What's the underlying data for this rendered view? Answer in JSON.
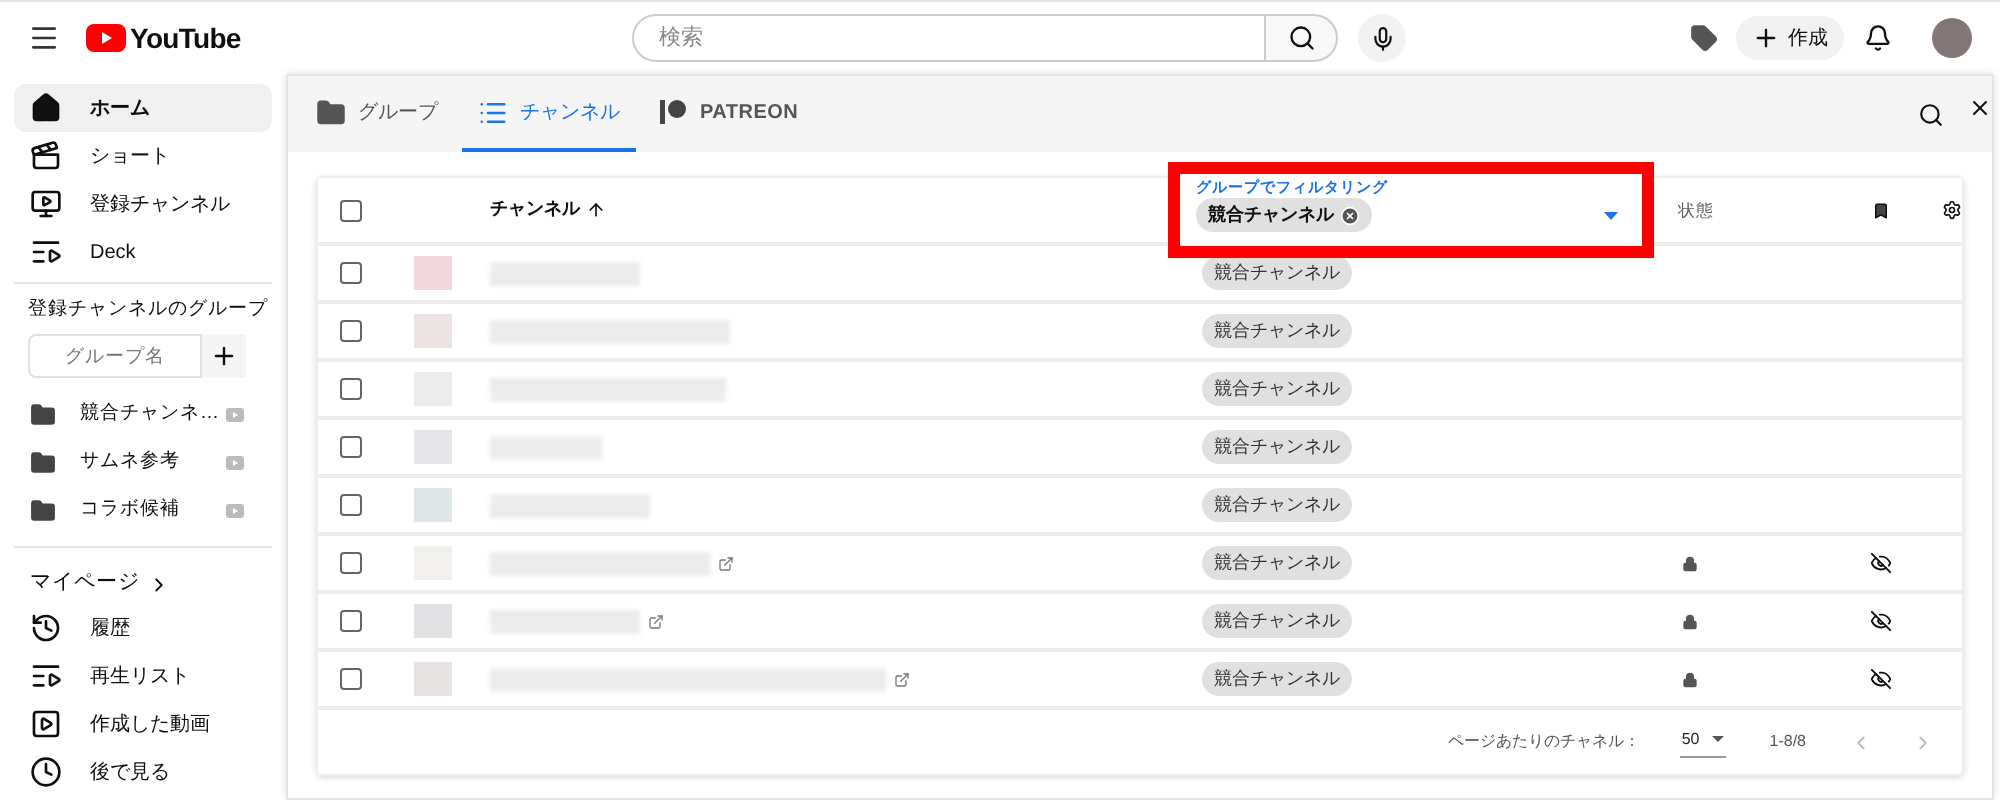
{
  "topbar": {
    "logo": "YouTube",
    "search": {
      "placeholder": "検索"
    },
    "create_button": "作成"
  },
  "sidebar": {
    "items": [
      {
        "label": "ホーム",
        "kind": "home",
        "selected": true
      },
      {
        "label": "ショート",
        "kind": "shorts",
        "selected": false
      },
      {
        "label": "登録チャンネル",
        "kind": "subscriptions",
        "selected": false
      },
      {
        "label": "Deck",
        "kind": "deck",
        "selected": false
      }
    ],
    "groups_title": "登録チャンネルのグループ",
    "group_name": {
      "placeholder": "グループ名"
    },
    "groups": [
      "競合チャンネ…",
      "サムネ参考",
      "コラボ候補"
    ],
    "mypage": "マイページ",
    "my_items": [
      {
        "label": "履歴",
        "kind": "history"
      },
      {
        "label": "再生リスト",
        "kind": "playlist"
      },
      {
        "label": "作成した動画",
        "kind": "videos"
      },
      {
        "label": "後で見る",
        "kind": "later"
      }
    ]
  },
  "panel": {
    "tabs": [
      {
        "label": "グループ",
        "kind": "folder",
        "selected": false
      },
      {
        "label": "チャンネル",
        "kind": "list",
        "selected": true
      },
      {
        "label": "PATREON",
        "kind": "patreon",
        "selected": false
      }
    ],
    "table": {
      "columns": {
        "channel": "チャンネル",
        "state": "状態"
      },
      "filter": {
        "label": "グループでフィルタリング",
        "chip": "競合チャンネル"
      },
      "select_all_checked": false,
      "rows": [
        {
          "checked": false,
          "group": "競合チャンネル",
          "external": false,
          "locked": false,
          "hidden": false
        },
        {
          "checked": false,
          "group": "競合チャンネル",
          "external": false,
          "locked": false,
          "hidden": false
        },
        {
          "checked": false,
          "group": "競合チャンネル",
          "external": false,
          "locked": false,
          "hidden": false
        },
        {
          "checked": false,
          "group": "競合チャンネル",
          "external": false,
          "locked": false,
          "hidden": false
        },
        {
          "checked": false,
          "group": "競合チャンネル",
          "external": false,
          "locked": false,
          "hidden": false
        },
        {
          "checked": false,
          "group": "競合チャンネル",
          "external": true,
          "locked": true,
          "hidden": true
        },
        {
          "checked": false,
          "group": "競合チャンネル",
          "external": true,
          "locked": true,
          "hidden": true
        },
        {
          "checked": false,
          "group": "競合チャンネル",
          "external": true,
          "locked": true,
          "hidden": true
        }
      ],
      "footer": {
        "per_page_label": "ページあたりのチャネル：",
        "per_page": "50",
        "range": "1-8/8"
      }
    }
  }
}
